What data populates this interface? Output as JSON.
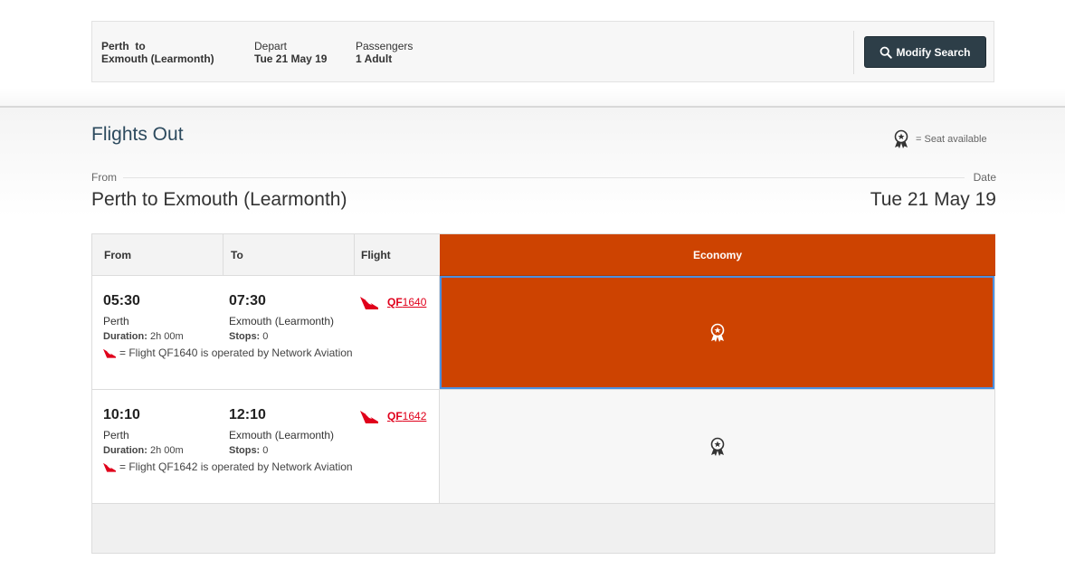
{
  "summary": {
    "route_line1": "Perth  to",
    "route_line2": "Exmouth (Learmonth)",
    "depart_label": "Depart",
    "depart_value": "Tue 21 May 19",
    "passengers_label": "Passengers",
    "passengers_value": "1 Adult",
    "modify_button": "Modify Search"
  },
  "section": {
    "title": "Flights Out",
    "legend_text": "= Seat available",
    "from_label": "From",
    "date_label": "Date",
    "route": "Perth to Exmouth (Learmonth)",
    "date": "Tue 21 May 19"
  },
  "table": {
    "headers": {
      "from": "From",
      "to": "To",
      "flight": "Flight",
      "economy": "Economy"
    },
    "rows": [
      {
        "depart_time": "05:30",
        "depart_city": "Perth",
        "duration_label": "Duration:",
        "duration": "2h 00m",
        "arrive_time": "07:30",
        "arrive_city": "Exmouth (Learmonth)",
        "stops_label": "Stops:",
        "stops": "0",
        "flight_prefix": "QF",
        "flight_number": "1640",
        "operated": "= Flight QF1640 is operated by Network Aviation"
      },
      {
        "depart_time": "10:10",
        "depart_city": "Perth",
        "duration_label": "Duration:",
        "duration": "2h 00m",
        "arrive_time": "12:10",
        "arrive_city": "Exmouth (Learmonth)",
        "stops_label": "Stops:",
        "stops": "0",
        "flight_prefix": "QF",
        "flight_number": "1642",
        "operated": "= Flight QF1642 is operated by Network Aviation"
      }
    ]
  },
  "colors": {
    "accent": "#cd4301",
    "button": "#2d3e48",
    "link": "#e0001b",
    "title": "#2c4a5e"
  },
  "icons": {
    "search": "search-icon",
    "seat": "award-ribbon-icon",
    "airline": "qantas-kangaroo-icon"
  }
}
